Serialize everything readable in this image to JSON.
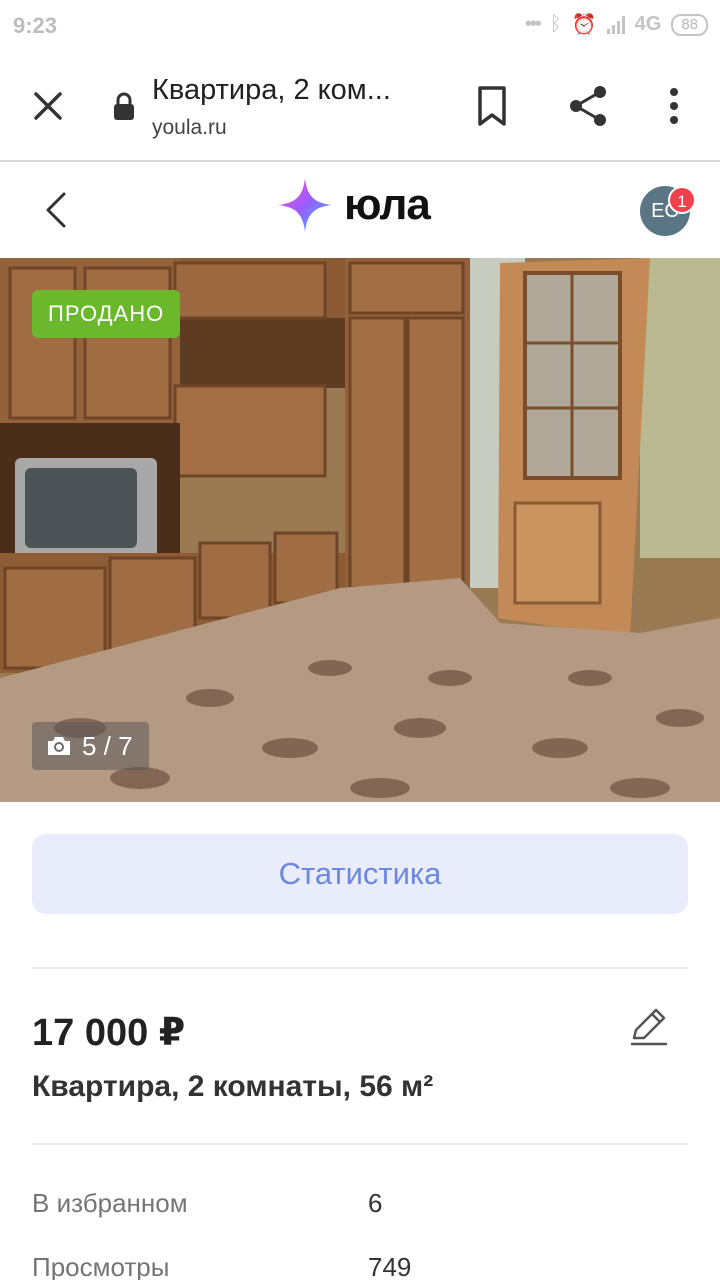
{
  "status_bar": {
    "time": "9:23",
    "network": "4G",
    "battery": "88"
  },
  "browser": {
    "page_title": "Квартира, 2 ком...",
    "domain": "youla.ru"
  },
  "site": {
    "logo_text": "юла",
    "avatar_initials": "ЕС",
    "notification_count": "1"
  },
  "photo": {
    "status_badge": "ПРОДАНО",
    "counter": "5 / 7"
  },
  "stats_button": {
    "label": "Статистика"
  },
  "listing": {
    "price": "17 000 ₽",
    "title": "Квартира, 2 комнаты, 56 м²"
  },
  "details": [
    {
      "label": "В избранном",
      "value": "6"
    },
    {
      "label": "Просмотры",
      "value": "749"
    }
  ],
  "colors": {
    "sold_green": "#6cb82c",
    "stats_bg": "#e9edfb",
    "stats_text": "#6c87e0",
    "badge_red": "#f0424c",
    "avatar_bg": "#5a7685"
  }
}
